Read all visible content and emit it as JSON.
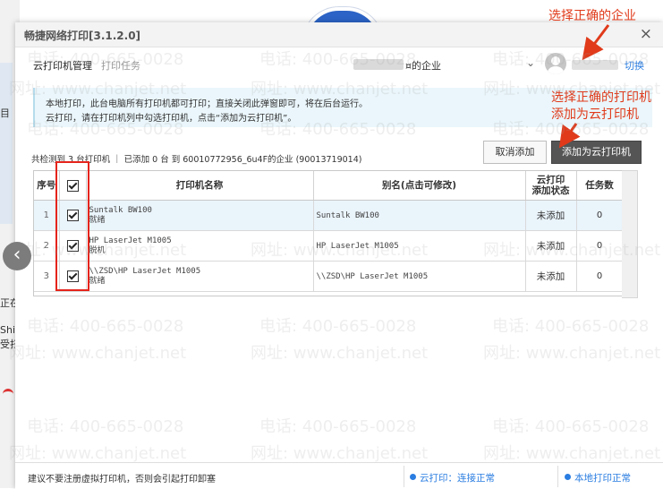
{
  "dialog": {
    "title": "畅捷网络打印[3.1.2.0]",
    "close_icon": "×"
  },
  "annotations": {
    "select_company": "选择正确的企业",
    "select_printer_line1": "选择正确的打印机",
    "select_printer_line2": "添加为云打印机",
    "color": "#e03a1a"
  },
  "tabs": [
    {
      "label": "云打印机管理",
      "active": true
    },
    {
      "label": "打印任务",
      "active": false
    }
  ],
  "header": {
    "company_suffix": "¤的企业",
    "dropdown_icon": "chevron-down-icon",
    "switch_label": "切换"
  },
  "notice": {
    "line1": "本地打印，此台电脑所有打印机都可打印；直接关闭此弹窗即可，将在后台运行。",
    "line2": "云打印，请在打印机列中勾选打印机，点击“添加为云打印机”。"
  },
  "summary": "共检测到 3 台打印机 ｜ 已添加 0 台 到 60010772956_6u4F的企业 (90013719014)",
  "buttons": {
    "cancel": "取消添加",
    "add": "添加为云打印机"
  },
  "table": {
    "headers": {
      "index": "序号",
      "name": "打印机名称",
      "alias": "别名(点击可修改)",
      "status_line1": "云打印",
      "status_line2": "添加状态",
      "count": "任务数"
    },
    "rows": [
      {
        "index": "1",
        "checked": true,
        "name": "Suntalk BW100",
        "state": "就绪",
        "alias": "Suntalk BW100",
        "status": "未添加",
        "count": "0"
      },
      {
        "index": "2",
        "checked": true,
        "name": "HP LaserJet M1005",
        "state": "脱机",
        "alias": "HP LaserJet M1005",
        "status": "未添加",
        "count": "0"
      },
      {
        "index": "3",
        "checked": true,
        "name": "\\\\ZSD\\HP LaserJet M1005",
        "state": "就绪",
        "alias": "\\\\ZSD\\HP LaserJet M1005",
        "status": "未添加",
        "count": "0"
      }
    ]
  },
  "statusbar": {
    "tip": "建议不要注册虚拟打印机，否则会引起打印卸塞",
    "cloud": "云打印：连接正常",
    "local": "本地打印正常"
  },
  "background": {
    "left_texts": [
      "目",
      "正在",
      "Shi",
      "受扫"
    ],
    "prev_icon": "‹"
  },
  "watermark": {
    "phone": "电话: 400-665-0028",
    "site": "网址: www.chanjet.net"
  }
}
